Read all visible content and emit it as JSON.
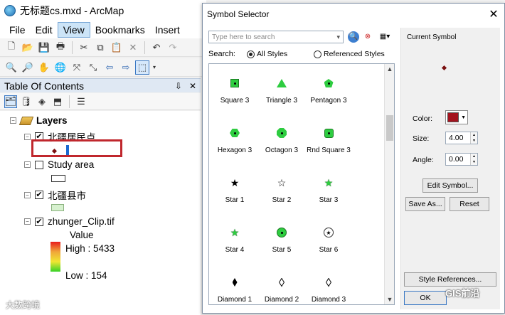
{
  "app": {
    "title": "无标题cs.mxd - ArcMap",
    "menu": [
      "File",
      "Edit",
      "View",
      "Bookmarks",
      "Insert"
    ],
    "active_menu": "View"
  },
  "toc": {
    "header": "Table Of Contents",
    "pin": "⇩",
    "close": "✕",
    "root": "Layers",
    "layers": [
      {
        "name": "北疆居民点",
        "checked": true
      },
      {
        "name": "Study area",
        "checked": false
      },
      {
        "name": "北疆县市",
        "checked": true
      },
      {
        "name": "zhunger_Clip.tif",
        "checked": true
      }
    ],
    "raster": {
      "field": "Value",
      "high": "High : 5433",
      "low": "Low : 154"
    }
  },
  "dialog": {
    "title": "Symbol Selector",
    "close": "✕",
    "search_placeholder": "Type here to search",
    "search_label": "Search:",
    "radio_all": "All Styles",
    "radio_ref": "Referenced Styles",
    "symbols": [
      {
        "label": "Square 3",
        "glyph": "square"
      },
      {
        "label": "Triangle 3",
        "glyph": "triangle"
      },
      {
        "label": "Pentagon 3",
        "glyph": "pentagon"
      },
      {
        "label": "Hexagon 3",
        "glyph": "hexagon"
      },
      {
        "label": "Octagon 3",
        "glyph": "octagon"
      },
      {
        "label": "Rnd Square 3",
        "glyph": "rnd-square"
      },
      {
        "label": "Star 1",
        "glyph": "star-black"
      },
      {
        "label": "Star 2",
        "glyph": "star-outline"
      },
      {
        "label": "Star 3",
        "glyph": "star-green"
      },
      {
        "label": "Star 4",
        "glyph": "star-green-outline"
      },
      {
        "label": "Star 5",
        "glyph": "star-circle"
      },
      {
        "label": "Star 6",
        "glyph": "star-white-circle"
      },
      {
        "label": "Diamond 1",
        "glyph": "diamond-black"
      },
      {
        "label": "Diamond 2",
        "glyph": "diamond-outline"
      },
      {
        "label": "Diamond 3",
        "glyph": "diamond-outline"
      }
    ],
    "current": {
      "title": "Current Symbol",
      "color_label": "Color:",
      "color": "#a3131e",
      "size_label": "Size:",
      "size": "4.00",
      "angle_label": "Angle:",
      "angle": "0.00",
      "edit_symbol": "Edit Symbol...",
      "save_as": "Save As...",
      "reset": "Reset",
      "style_references": "Style References...",
      "ok": "OK"
    }
  },
  "watermark": {
    "right": "GIS前沿",
    "left": "大数跨境"
  }
}
